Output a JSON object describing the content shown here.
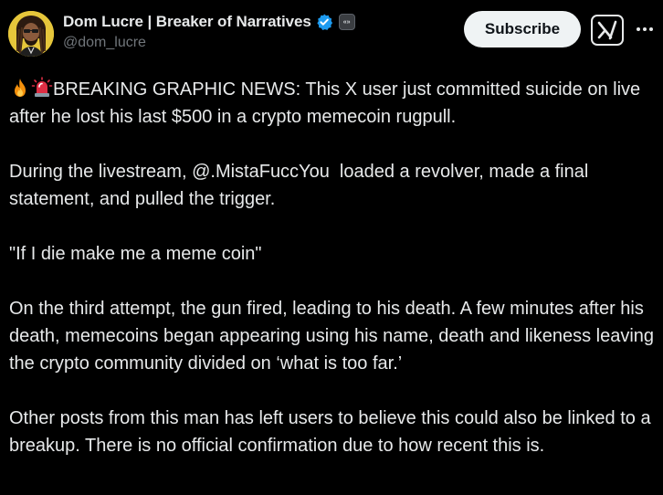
{
  "author": {
    "display_name": "Dom Lucre | Breaker of Narratives",
    "handle": "@dom_lucre",
    "affiliate_badge_text": "«»"
  },
  "actions": {
    "subscribe_label": "Subscribe"
  },
  "colors": {
    "background": "#000000",
    "text": "#e7e9ea",
    "secondary_text": "#71767b",
    "verified_blue": "#1d9bf0",
    "button_bg": "#eff3f4"
  },
  "icons": {
    "verified": "verified-badge-icon",
    "grok": "grok-icon",
    "more": "more-options-icon",
    "emoji_1": "fire-emoji",
    "emoji_2": "police-light-emoji"
  },
  "tweet": {
    "paragraphs": [
      "BREAKING GRAPHIC NEWS: This X user just committed suicide on live after he lost his last $500 in a crypto memecoin rugpull.",
      "During the livestream, @.MistaFuccYou  loaded a revolver, made a final statement, and pulled the trigger.",
      "\"If I die make me a meme coin\"",
      "On the third attempt, the gun fired, leading to his death. A few minutes after his death, memecoins began appearing using his name, death and likeness leaving the crypto community divided on ‘what is too far.’",
      "Other posts from this man has left users to believe this could also be linked to a breakup. There is no official confirmation due to how recent this is."
    ]
  }
}
